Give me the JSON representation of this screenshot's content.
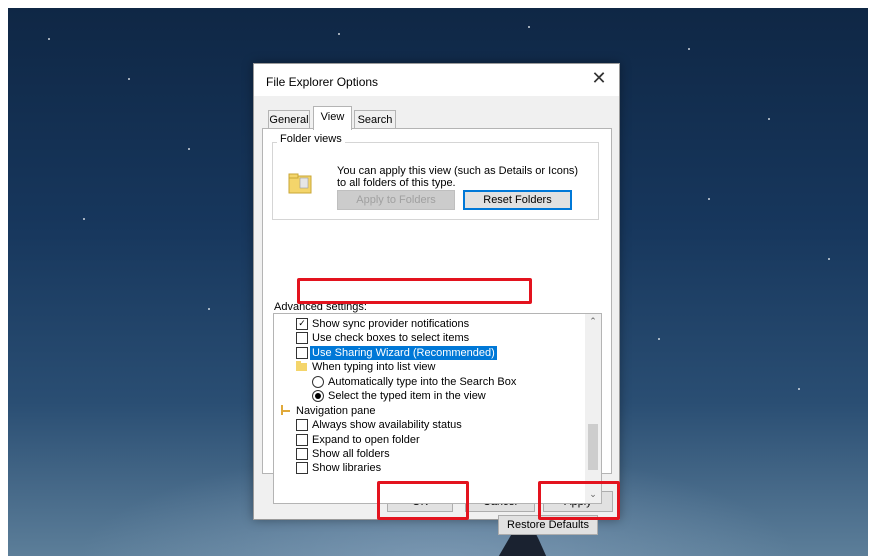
{
  "dialog": {
    "title": "File Explorer Options",
    "close_glyph": "✕"
  },
  "tabs": [
    {
      "label": "General",
      "active": false
    },
    {
      "label": "View",
      "active": true
    },
    {
      "label": "Search",
      "active": false
    }
  ],
  "folder_views": {
    "legend": "Folder views",
    "description": "You can apply this view (such as Details or Icons) to all folders of this type.",
    "apply_button": "Apply to Folders",
    "reset_button": "Reset Folders"
  },
  "advanced": {
    "label": "Advanced settings:",
    "items": [
      {
        "type": "checkbox",
        "label": "Show sync provider notifications",
        "checked": true
      },
      {
        "type": "checkbox",
        "label": "Use check boxes to select items",
        "checked": false
      },
      {
        "type": "checkbox",
        "label": "Use Sharing Wizard (Recommended)",
        "checked": false,
        "selected": true
      },
      {
        "type": "folder",
        "label": "When typing into list view"
      },
      {
        "type": "radio",
        "label": "Automatically type into the Search Box",
        "checked": false
      },
      {
        "type": "radio",
        "label": "Select the typed item in the view",
        "checked": true
      },
      {
        "type": "tree",
        "label": "Navigation pane"
      },
      {
        "type": "checkbox",
        "label": "Always show availability status",
        "checked": false
      },
      {
        "type": "checkbox",
        "label": "Expand to open folder",
        "checked": false
      },
      {
        "type": "checkbox",
        "label": "Show all folders",
        "checked": false
      },
      {
        "type": "checkbox",
        "label": "Show libraries",
        "checked": false
      }
    ],
    "scroll_up_glyph": "⌃",
    "scroll_down_glyph": "⌄"
  },
  "restore_button": "Restore Defaults",
  "footer": {
    "ok": "OK",
    "cancel": "Cancel",
    "apply": "Apply"
  },
  "colors": {
    "highlight": "#e3131e",
    "selection": "#0078d7"
  }
}
